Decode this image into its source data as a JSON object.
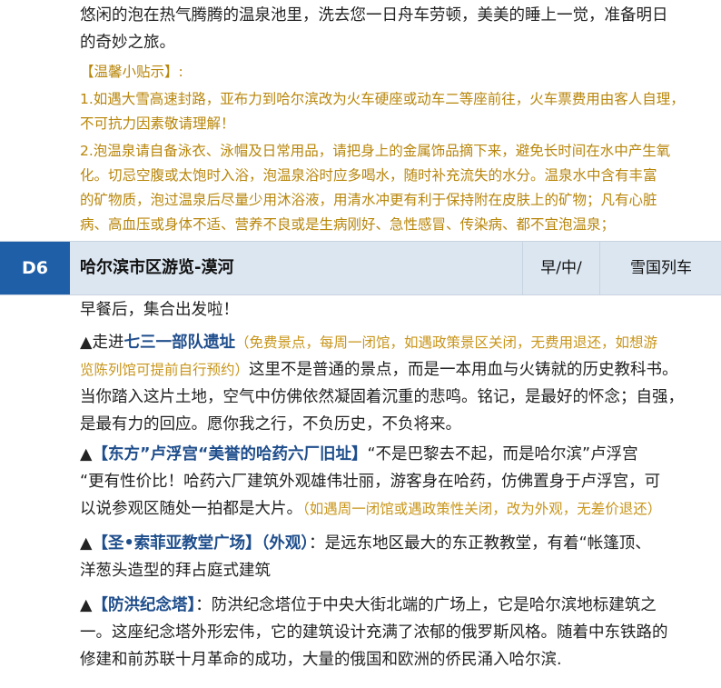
{
  "intro": {
    "line1": "悠闲的泡在热气腾腾的温泉池里，洗去您一日舟车劳顿，美美的睡上一觉，准备明日",
    "line2": "的奇妙之旅。"
  },
  "tips": {
    "title": "【温馨小贴示】:",
    "item1_line1": "1.如遇大雪高速封路，亚布力到哈尔滨改为火车硬座或动车二等座前往，火车票费用由客人自理，",
    "item1_line2": "不可抗力因素敬请理解！",
    "item2_line1": "2.泡温泉请自备泳衣、泳帽及日常用品，请把身上的金属饰品摘下来，避免长时间在水中产生氧",
    "item2_line2": "化。切忌空腹或太饱时入浴，泡温泉浴时应多喝水，随时补充流失的水分。温泉水中含有丰富",
    "item2_line3": "的矿物质，泡过温泉后尽量少用沐浴液，用清水冲更有利于保持附在皮肤上的矿物；凡有心脏",
    "item2_line4": "病、高血压或身体不适、营养不良或是生病刚好、急性感冒、传染病、都不宜泡温泉；"
  },
  "day": {
    "badge": "D6",
    "title": "哈尔滨市区游览-漠河",
    "meals": "早/中/",
    "lodging": "雪国列车"
  },
  "body": {
    "breakfast": "早餐后，集合出发啦！",
    "s1": {
      "prefix": "▲走进",
      "name": "七三一部队遗址",
      "note_line1": "（免费景点，每周一闭馆，如遇政策景区关闭，无费用退还，如想游",
      "note_line2": "览陈列馆可提前自行预约）",
      "desc_line1": "这里不是普通的景点，而是一本用血与火铸就的历史教科书。",
      "desc_line2": "当你踏入这片土地，空气中仿佛依然凝固着沉重的悲鸣。铭记，是最好的怀念；自强，",
      "desc_line3": "是最有力的回应。愿你我之行，不负历史，不负将来。"
    },
    "s2": {
      "prefix": "▲",
      "name": "【东方”卢浮宫“美誉的哈药六厂旧址】",
      "desc_line1": "“不是巴黎去不起，而是哈尔滨”卢浮宫",
      "desc_line2": "“更有性价比！哈药六厂建筑外观雄伟壮丽，游客身在哈药，仿佛置身于卢浮宫，可",
      "desc_line3": "以说参观区随处一拍都是大片。",
      "note": "（如遇周一闭馆或遇政策性关闭，改为外观，无差价退还）"
    },
    "s3": {
      "prefix": "▲",
      "name": "【圣•索菲亚教堂广场】（外观）",
      "desc_line1": "：是远东地区最大的东正教教堂，有着“帐篷顶、",
      "desc_line2": "洋葱头造型的拜占庭式建筑"
    },
    "s4": {
      "prefix": "▲",
      "name": "【防洪纪念塔】",
      "desc_line1": "：防洪纪念塔位于中央大街北端的广场上，它是哈尔滨地标建筑之",
      "desc_line2": "一。这座纪念塔外形宏伟，它的建筑设计充满了浓郁的俄罗斯风格。随着中东铁路的",
      "desc_line3": "修建和前苏联十月革命的成功，大量的俄国和欧洲的侨民涌入哈尔滨."
    }
  }
}
